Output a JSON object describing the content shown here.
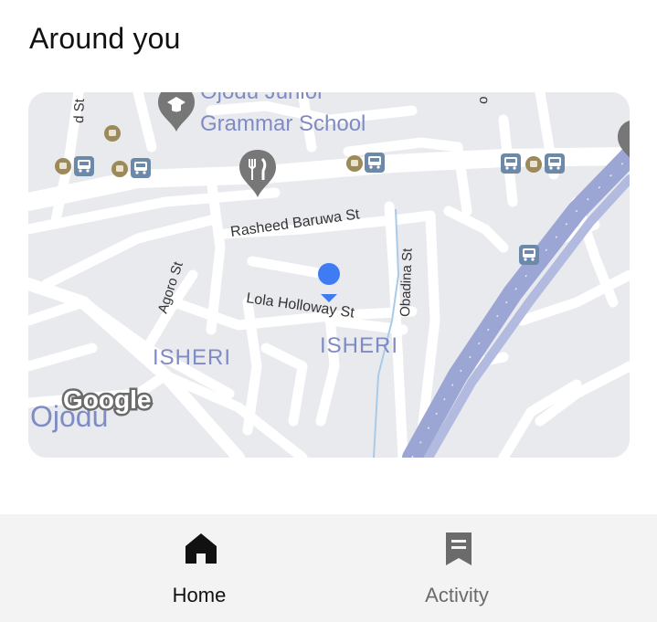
{
  "section": {
    "title": "Around you"
  },
  "map": {
    "labels": {
      "school": "Ojodu Junior\nGrammar School",
      "rasheed": "Rasheed Baruwa St",
      "lola": "Lola Holloway St",
      "agoro": "Agoro St",
      "obadina": "Obadina St",
      "isheri_left": "ISHERI",
      "isheri_right": "ISHERI",
      "ojodu": "Ojodu",
      "d_st": "d St",
      "google_logo": "Google"
    },
    "colors": {
      "background": "#e9eaee",
      "road": "#ffffff",
      "highway": "#9ca6d4",
      "highway_edge": "#b9c0e2",
      "water": "#a9cbe8",
      "location_dot": "#3f7bf3",
      "transit_icon": "#6c89a9",
      "bus_stop_dot": "#9c8a5a",
      "poi_pin": "#777777",
      "district_label": "#7f8bc4"
    },
    "icons": [
      "restaurant-pin-icon",
      "school-pin-icon",
      "bus-stop-icon",
      "location-dot-icon"
    ]
  },
  "tabbar": {
    "tabs": [
      {
        "label": "Home",
        "icon": "home-icon",
        "active": true
      },
      {
        "label": "Activity",
        "icon": "receipt-icon",
        "active": false
      }
    ]
  }
}
